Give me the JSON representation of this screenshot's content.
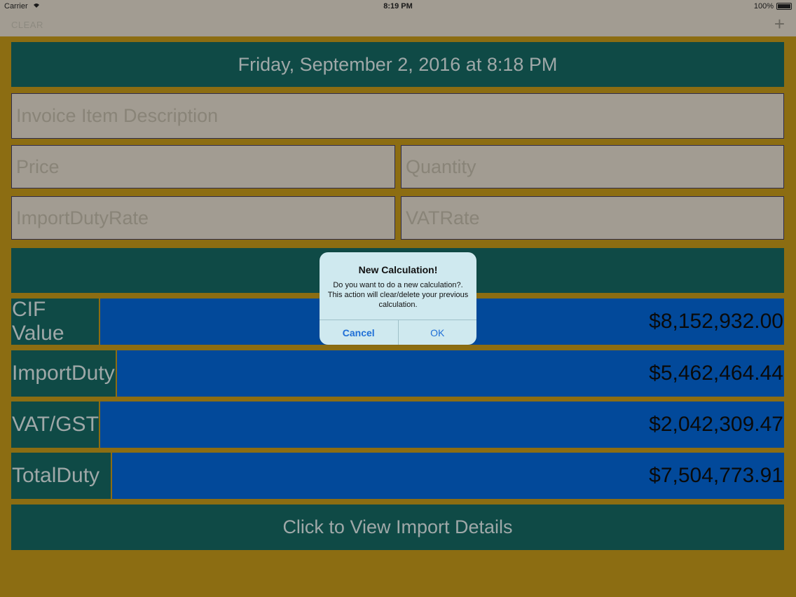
{
  "status_bar": {
    "carrier": "Carrier",
    "time": "8:19 PM",
    "battery": "100%"
  },
  "nav": {
    "clear_label": "CLEAR",
    "add_label": "+"
  },
  "date_banner": "Friday, September 2, 2016 at 8:18 PM",
  "inputs": {
    "description_placeholder": "Invoice Item Description",
    "price_placeholder": "Price",
    "quantity_placeholder": "Quantity",
    "import_duty_rate_placeholder": "ImportDutyRate",
    "vat_rate_placeholder": "VATRate"
  },
  "results": [
    {
      "label": "CIF Value",
      "value": "$8,152,932.00"
    },
    {
      "label": "ImportDuty",
      "value": "$5,462,464.44"
    },
    {
      "label": "VAT/GST",
      "value": "$2,042,309.47"
    },
    {
      "label": "TotalDuty",
      "value": "$7,504,773.91"
    }
  ],
  "view_details_label": "Click to View Import Details",
  "alert": {
    "title": "New Calculation!",
    "message": "Do you want to do a new calculation?. This action will clear/delete your previous calculation.",
    "cancel_label": "Cancel",
    "ok_label": "OK"
  },
  "colors": {
    "background": "#8c6d12",
    "teal": "#0f4a46",
    "blue": "#02499a",
    "field": "#a29c92",
    "alert_bg": "#cfe9ef",
    "alert_button": "#1f6fd6"
  }
}
